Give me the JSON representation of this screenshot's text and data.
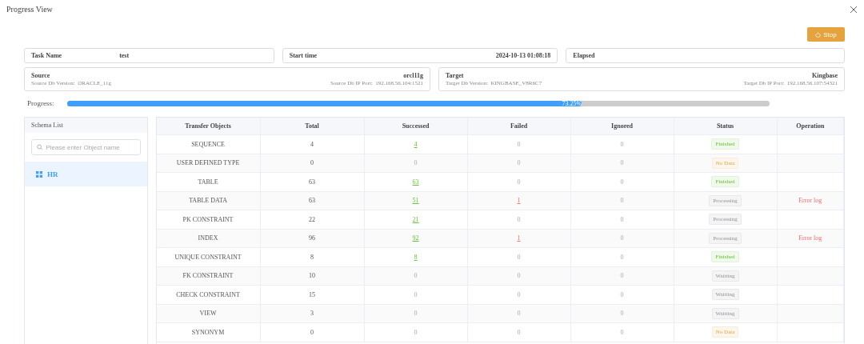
{
  "window": {
    "title": "Progress View"
  },
  "stop_button": "Stop",
  "task": {
    "name_label": "Task Name",
    "name": "test",
    "start_label": "Start time",
    "start": "2024-10-13 01:08:18",
    "elapsed_label": "Elapsed"
  },
  "source": {
    "title": "Source",
    "name": "orcl11g",
    "version_label": "Source Db Version:",
    "version": "ORACLE_11g",
    "ip_label": "Source Db IP Port:",
    "ip": "192.168.56.104:1521"
  },
  "target": {
    "title": "Target",
    "name": "Kingbase",
    "version_label": "Target Db Version:",
    "version": "KINGBASE_V8R6C7",
    "ip_label": "Target Db IP Port:",
    "ip": "192.168.56.107:54321"
  },
  "progress": {
    "label": "Progress:",
    "level": 0.7325,
    "reading": "73.25%"
  },
  "sidebar": {
    "title": "Schema List",
    "search": {
      "placeholder": "Please enter Object name"
    },
    "items": [
      {
        "label": "HR",
        "selected": true
      }
    ]
  },
  "table": {
    "columns": [
      "Transfer Objects",
      "Total",
      "Successed",
      "Failed",
      "Ignored",
      "Status",
      "Operation"
    ],
    "rows": [
      {
        "object": "SEQUENCE",
        "total": "4",
        "successed": "4",
        "successed_link": true,
        "failed": "0",
        "failed_link": false,
        "ignored": "0",
        "status": "Finished",
        "kind": "finished"
      },
      {
        "object": "USER DEFINED TYPE",
        "total": "0",
        "successed": "0",
        "successed_link": false,
        "failed": "0",
        "failed_link": false,
        "ignored": "0",
        "status": "No Data",
        "kind": "nodata"
      },
      {
        "object": "TABLE",
        "total": "63",
        "successed": "63",
        "successed_link": true,
        "failed": "0",
        "failed_link": false,
        "ignored": "0",
        "status": "Finished",
        "kind": "finished"
      },
      {
        "object": "TABLE DATA",
        "total": "63",
        "successed": "51",
        "successed_link": true,
        "failed": "1",
        "failed_link": true,
        "ignored": "0",
        "status": "Processing",
        "kind": "processing",
        "operation": "Error log"
      },
      {
        "object": "PK CONSTRAINT",
        "total": "22",
        "successed": "21",
        "successed_link": true,
        "failed": "0",
        "failed_link": false,
        "ignored": "0",
        "status": "Processing",
        "kind": "processing"
      },
      {
        "object": "INDEX",
        "total": "96",
        "successed": "92",
        "successed_link": true,
        "failed": "1",
        "failed_link": true,
        "ignored": "0",
        "status": "Processing",
        "kind": "processing",
        "operation": "Error log"
      },
      {
        "object": "UNIQUE CONSTRAINT",
        "total": "8",
        "successed": "8",
        "successed_link": true,
        "failed": "0",
        "failed_link": false,
        "ignored": "0",
        "status": "Finished",
        "kind": "finished"
      },
      {
        "object": "FK CONSTRAINT",
        "total": "10",
        "successed": "0",
        "successed_link": false,
        "failed": "0",
        "failed_link": false,
        "ignored": "0",
        "status": "Waitting",
        "kind": "waiting"
      },
      {
        "object": "CHECK CONSTRAINT",
        "total": "15",
        "successed": "0",
        "successed_link": false,
        "failed": "0",
        "failed_link": false,
        "ignored": "0",
        "status": "Waitting",
        "kind": "waiting"
      },
      {
        "object": "VIEW",
        "total": "3",
        "successed": "0",
        "successed_link": false,
        "failed": "0",
        "failed_link": false,
        "ignored": "0",
        "status": "Waitting",
        "kind": "waiting"
      },
      {
        "object": "SYNONYM",
        "total": "0",
        "successed": "0",
        "successed_link": false,
        "failed": "0",
        "failed_link": false,
        "ignored": "0",
        "status": "No Data",
        "kind": "nodata"
      }
    ]
  }
}
